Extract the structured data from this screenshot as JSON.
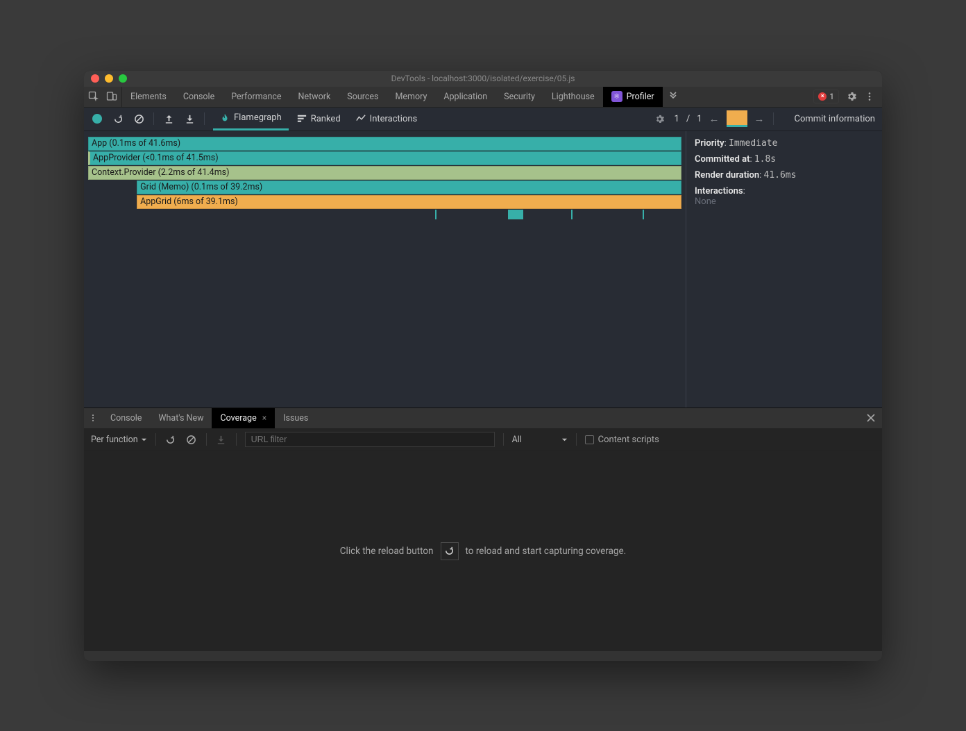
{
  "window": {
    "title": "DevTools - localhost:3000/isolated/exercise/05.js"
  },
  "topTabs": {
    "items": [
      "Elements",
      "Console",
      "Performance",
      "Network",
      "Sources",
      "Memory",
      "Application",
      "Security",
      "Lighthouse"
    ],
    "profiler": "Profiler",
    "errors": "1"
  },
  "profilerBar": {
    "views": {
      "flamegraph": "Flamegraph",
      "ranked": "Ranked",
      "interactions": "Interactions"
    },
    "commitNav": {
      "current": "1",
      "sep": "/",
      "total": "1"
    },
    "sidebarTitle": "Commit information"
  },
  "flame": {
    "rows": [
      {
        "label": "App (0.1ms of 41.6ms)",
        "indent": 0,
        "widthPct": 100,
        "color": "c-teal"
      },
      {
        "label": "AppProvider (<0.1ms of 41.5ms)",
        "indent": 0,
        "widthPct": 100,
        "color": "c-teal"
      },
      {
        "label": "Context.Provider (2.2ms of 41.4ms)",
        "indent": 0,
        "widthPct": 100,
        "color": "c-olive"
      },
      {
        "label": "Grid (Memo) (0.1ms of 39.2ms)",
        "indent": 8.2,
        "widthPct": 91.8,
        "color": "c-teal"
      },
      {
        "label": "AppGrid (6ms of 39.1ms)",
        "indent": 8.2,
        "widthPct": 91.8,
        "color": "c-amber"
      }
    ],
    "marks": [
      {
        "leftPct": 58.5,
        "wide": false
      },
      {
        "leftPct": 70.8,
        "wide": true
      },
      {
        "leftPct": 81.4,
        "wide": false
      },
      {
        "leftPct": 93.4,
        "wide": false
      }
    ]
  },
  "sidebar": {
    "priorityLabel": "Priority",
    "priorityValue": "Immediate",
    "committedLabel": "Committed at",
    "committedValue": "1.8s",
    "renderLabel": "Render duration",
    "renderValue": "41.6ms",
    "interactionsLabel": "Interactions",
    "interactionsValue": "None"
  },
  "drawer": {
    "tabs": {
      "console": "Console",
      "whatsnew": "What's New",
      "coverage": "Coverage",
      "issues": "Issues"
    },
    "toolbar": {
      "scope": "Per function",
      "urlPlaceholder": "URL filter",
      "typeFilter": "All",
      "contentScripts": "Content scripts"
    },
    "emptyState": {
      "pre": "Click the reload button",
      "post": "to reload and start capturing coverage."
    }
  }
}
